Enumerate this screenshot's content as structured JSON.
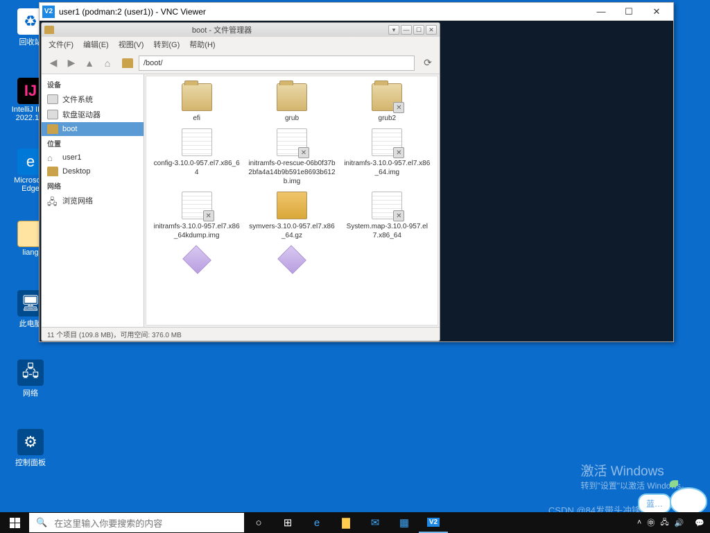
{
  "desktop_icons": {
    "recycle": "回收站",
    "intellij_line1": "IntelliJ ID...",
    "intellij_line2": "2022.1...",
    "edge_line1": "Microso...",
    "edge_line2": "Edge",
    "liang": "liang",
    "pc": "此电脑",
    "net": "网络",
    "cp": "控制面板"
  },
  "vnc": {
    "title": "user1 (podman:2 (user1)) - VNC Viewer",
    "logo": "V2"
  },
  "fm": {
    "title": "boot - 文件管理器",
    "menu": [
      "文件(F)",
      "编辑(E)",
      "视图(V)",
      "转到(G)",
      "帮助(H)"
    ],
    "path": "/boot/",
    "side_header1": "设备",
    "side_drives": [
      "文件系统",
      "软盘驱动器"
    ],
    "side_boot": "boot",
    "side_header2": "位置",
    "side_user": "user1",
    "side_desktop": "Desktop",
    "side_header3": "网络",
    "side_network": "浏览网络",
    "files": [
      {
        "name": "efi",
        "type": "folder",
        "locked": false
      },
      {
        "name": "grub",
        "type": "folder",
        "locked": false
      },
      {
        "name": "grub2",
        "type": "folder",
        "locked": true
      },
      {
        "name": "config-3.10.0-957.el7.x86_64",
        "type": "doc",
        "locked": false
      },
      {
        "name": "initramfs-0-rescue-06b0f37b2bfa4a14b9b591e8693b612b.img",
        "type": "doc",
        "locked": true
      },
      {
        "name": "initramfs-3.10.0-957.el7.x86_64.img",
        "type": "doc",
        "locked": true
      },
      {
        "name": "initramfs-3.10.0-957.el7.x86_64kdump.img",
        "type": "doc",
        "locked": true
      },
      {
        "name": "symvers-3.10.0-957.el7.x86_64.gz",
        "type": "pkg",
        "locked": false
      },
      {
        "name": "System.map-3.10.0-957.el7.x86_64",
        "type": "doc",
        "locked": true
      },
      {
        "name": "",
        "type": "exec",
        "locked": false
      },
      {
        "name": "",
        "type": "exec",
        "locked": false
      }
    ],
    "status": "11 个项目 (109.8 MB)，可用空间: 376.0 MB"
  },
  "watermark": {
    "l1": "激活 Windows",
    "l2": "转到\"设置\"以激活 Windows。"
  },
  "csdn": "CSDN @84发带头冲锋",
  "speech": "蓝…",
  "taskbar": {
    "search_placeholder": "在这里输入你要搜索的内容",
    "time": "",
    "date": ""
  }
}
